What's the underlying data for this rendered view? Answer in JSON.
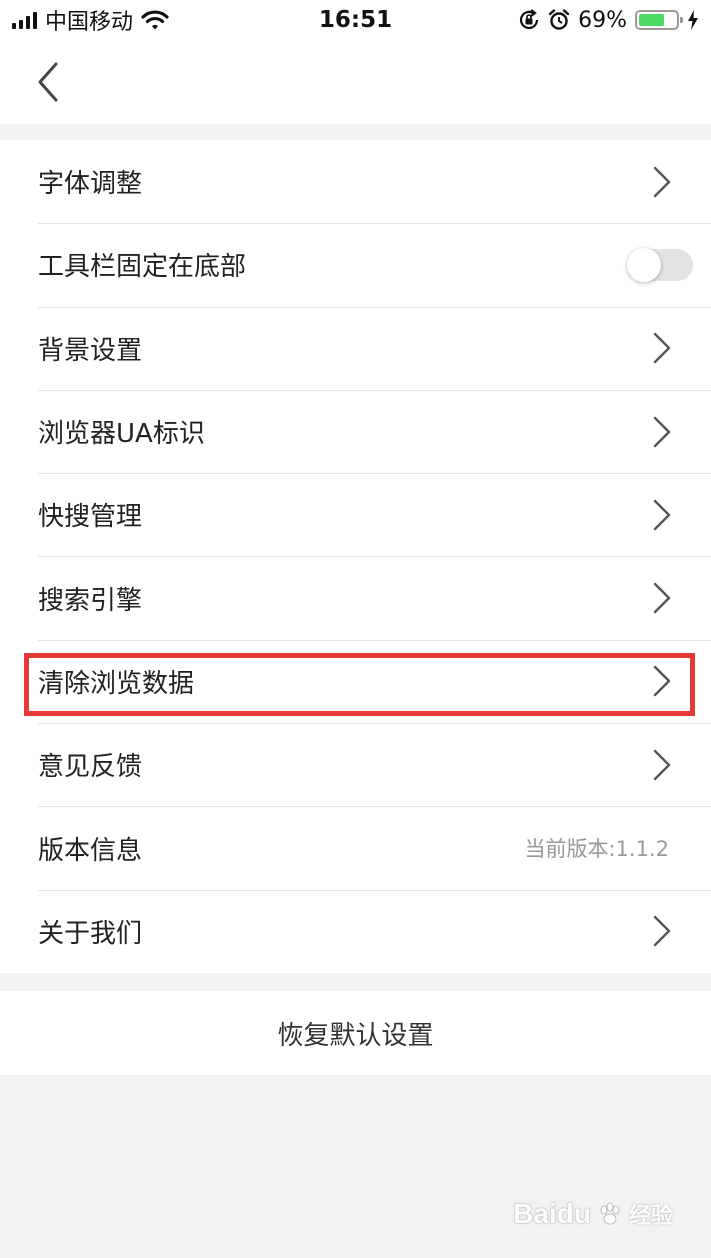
{
  "status_bar": {
    "carrier": "中国移动",
    "time": "16:51",
    "battery_percent": "69%",
    "battery_level": 0.69,
    "battery_color": "#4cd964"
  },
  "nav": {
    "back_icon": "chevron-left-icon"
  },
  "settings": {
    "items": [
      {
        "label": "字体调整",
        "accessory": "chevron"
      },
      {
        "label": "工具栏固定在底部",
        "accessory": "toggle",
        "toggle_on": false
      },
      {
        "label": "背景设置",
        "accessory": "chevron"
      },
      {
        "label": "浏览器UA标识",
        "accessory": "chevron"
      },
      {
        "label": "快搜管理",
        "accessory": "chevron"
      },
      {
        "label": "搜索引擎",
        "accessory": "chevron"
      },
      {
        "label": "清除浏览数据",
        "accessory": "chevron",
        "highlighted": true
      },
      {
        "label": "意见反馈",
        "accessory": "chevron"
      },
      {
        "label": "版本信息",
        "accessory": "value",
        "value": "当前版本:1.1.2"
      },
      {
        "label": "关于我们",
        "accessory": "chevron"
      }
    ]
  },
  "reset": {
    "label": "恢复默认设置"
  },
  "watermark": {
    "brand": "Baidu",
    "suffix": "经验"
  },
  "colors": {
    "highlight": "#e53935",
    "background": "#f2f2f2",
    "divider": "#e4e4e4"
  }
}
